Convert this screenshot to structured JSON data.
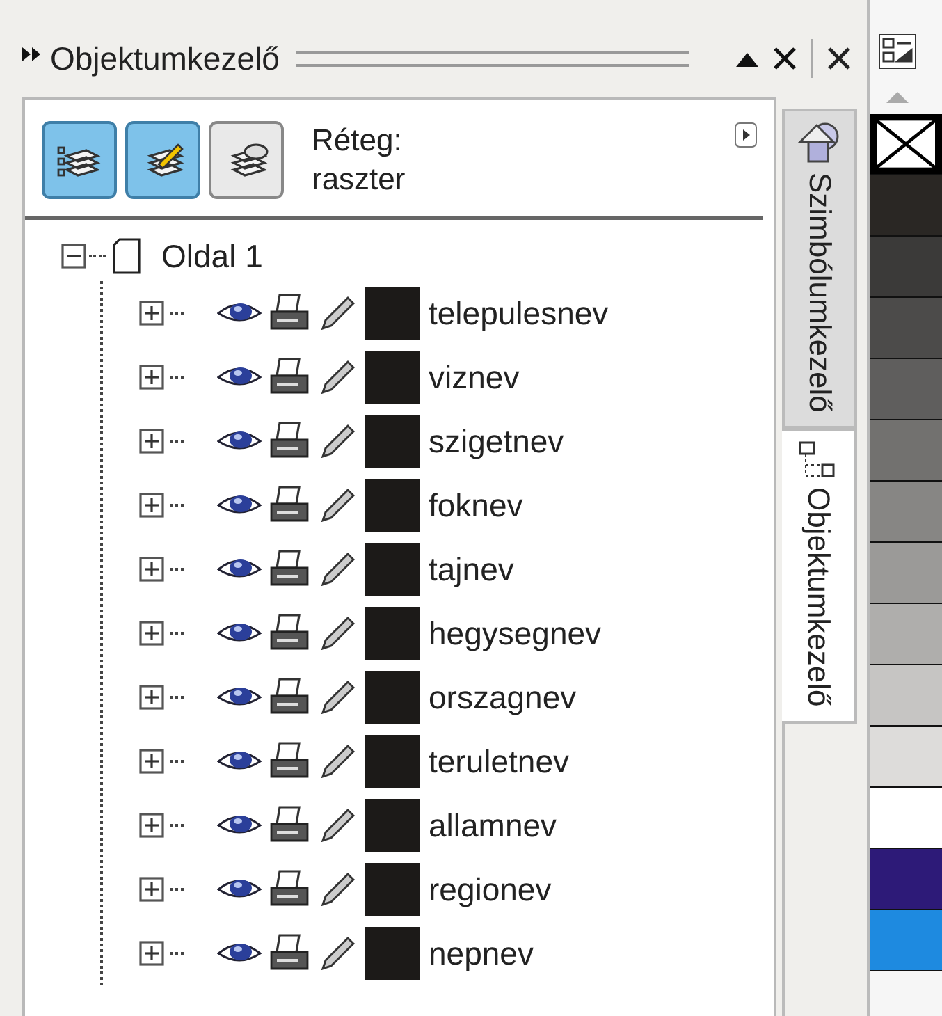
{
  "docker": {
    "title": "Objektumkezelő"
  },
  "toolbar": {
    "buttons": [
      {
        "selected": true
      },
      {
        "selected": true
      },
      {
        "selected": false
      }
    ],
    "layer_label": "Réteg:",
    "layer_name": "raszter"
  },
  "tree": {
    "label": "Oldal 1",
    "expanded": true,
    "children": [
      {
        "label": "telepulesnev",
        "expanded": false,
        "color": "#1c1a18"
      },
      {
        "label": "viznev",
        "expanded": false,
        "color": "#1c1a18"
      },
      {
        "label": "szigetnev",
        "expanded": false,
        "color": "#1c1a18"
      },
      {
        "label": "foknev",
        "expanded": false,
        "color": "#1c1a18"
      },
      {
        "label": "tajnev",
        "expanded": false,
        "color": "#1c1a18"
      },
      {
        "label": "hegysegnev",
        "expanded": false,
        "color": "#1c1a18"
      },
      {
        "label": "orszagnev",
        "expanded": false,
        "color": "#1c1a18"
      },
      {
        "label": "teruletnev",
        "expanded": false,
        "color": "#1c1a18"
      },
      {
        "label": "allamnev",
        "expanded": false,
        "color": "#1c1a18"
      },
      {
        "label": "regionev",
        "expanded": false,
        "color": "#1c1a18"
      },
      {
        "label": "nepnev",
        "expanded": false,
        "color": "#1c1a18"
      }
    ]
  },
  "tabs": [
    {
      "label": "Szimbólumkezelő",
      "selected": false
    },
    {
      "label": "Objektumkezelő",
      "selected": true
    }
  ],
  "palette": {
    "swatches": [
      {
        "kind": "none"
      },
      {
        "kind": "color",
        "color": "#2a2724"
      },
      {
        "kind": "color",
        "color": "#3b3a39"
      },
      {
        "kind": "color",
        "color": "#4c4b4a"
      },
      {
        "kind": "color",
        "color": "#5f5e5d"
      },
      {
        "kind": "color",
        "color": "#72716f"
      },
      {
        "kind": "color",
        "color": "#878684"
      },
      {
        "kind": "color",
        "color": "#9b9a98"
      },
      {
        "kind": "color",
        "color": "#afaeac"
      },
      {
        "kind": "color",
        "color": "#c6c5c3"
      },
      {
        "kind": "color",
        "color": "#dddcda"
      },
      {
        "kind": "color",
        "color": "#ffffff"
      },
      {
        "kind": "color",
        "color": "#2d1a78"
      },
      {
        "kind": "color",
        "color": "#1e8ae0"
      }
    ]
  }
}
